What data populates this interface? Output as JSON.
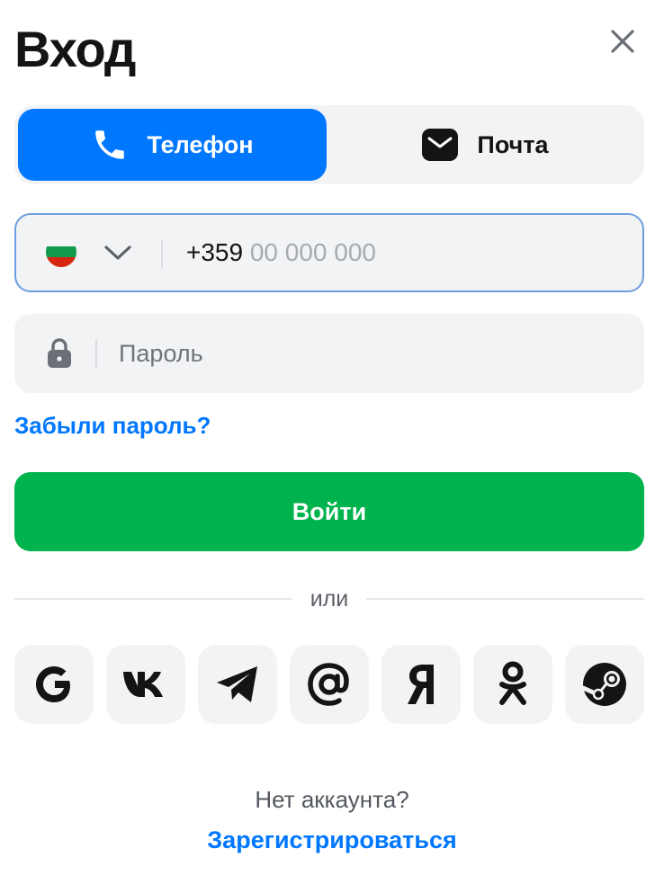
{
  "header": {
    "title": "Вход",
    "close_icon": "close-icon"
  },
  "tabs": [
    {
      "label": "Телефон",
      "icon": "phone-icon",
      "active": true
    },
    {
      "label": "Почта",
      "icon": "mail-icon",
      "active": false
    }
  ],
  "phone_input": {
    "country_flag": "bulgaria-flag-icon",
    "dropdown_icon": "chevron-down-icon",
    "country_code": "+359",
    "mask_placeholder": "00 000 000"
  },
  "password_input": {
    "icon": "lock-icon",
    "placeholder": "Пароль",
    "value": ""
  },
  "forgot_password": "Забыли пароль?",
  "login_button": "Войти",
  "divider_text": "или",
  "social_logins": [
    {
      "icon": "google-icon"
    },
    {
      "icon": "vk-icon"
    },
    {
      "icon": "telegram-icon"
    },
    {
      "icon": "mail-ru-icon"
    },
    {
      "icon": "yandex-icon"
    },
    {
      "icon": "odnoklassniki-icon"
    },
    {
      "icon": "steam-icon"
    }
  ],
  "footer": {
    "no_account": "Нет аккаунта?",
    "register_link": "Зарегистрироваться"
  },
  "colors": {
    "accent": "#0077ff",
    "primary_button": "#00b34c",
    "field_background": "#f2f3f5",
    "focus_border": "#6d9fe0"
  }
}
